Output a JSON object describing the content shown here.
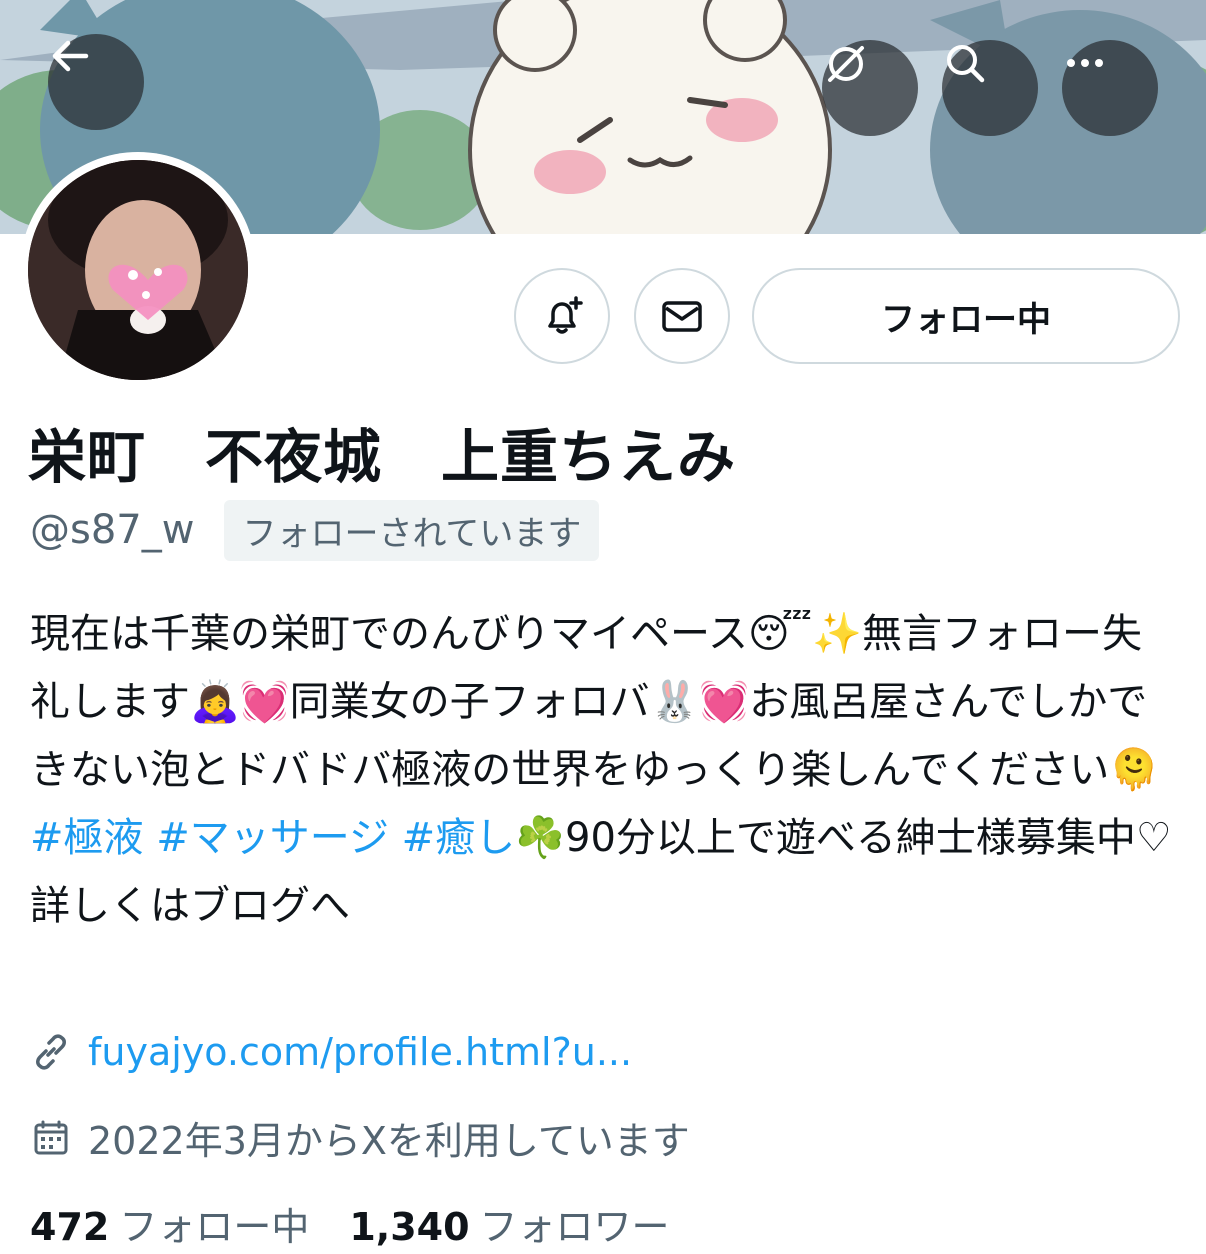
{
  "colors": {
    "accent": "#1d9bf0",
    "secondary_text": "#536471",
    "primary_text": "#0f1419",
    "border": "#cfd9de"
  },
  "nav": {
    "back_icon": "arrow-left-icon",
    "no_translate_icon": "slash-circle-icon",
    "search_icon": "search-icon",
    "more_icon": "more-horizontal-icon"
  },
  "actions": {
    "notify_icon": "bell-plus-icon",
    "message_icon": "envelope-icon",
    "follow_label": "フォロー中"
  },
  "profile": {
    "display_name": "栄町　不夜城　上重ちえみ",
    "handle": "@s87_w",
    "follows_you": "フォローされています",
    "bio": {
      "part1": "現在は千葉の栄町でのんびりマイペース😴✨無言フォロー失礼します🙇‍♀️💓同業女の子フォロバ🐰💓お風呂屋さんでしかできない泡とドバドバ極液の世界をゆっくり楽しんでください🫠",
      "tag1": "#極液",
      "tag2": "#マッサージ",
      "tag3": "#癒し",
      "part2": "☘️90分以上で遊べる紳士様募集中♡詳しくはブログへ"
    },
    "link": "fuyajyo.com/profile.html?u...",
    "joined": "2022年3月からXを利用しています"
  },
  "stats": {
    "following_count": "472",
    "following_label": "フォロー中",
    "followers_count": "1,340",
    "followers_label": "フォロワー"
  }
}
